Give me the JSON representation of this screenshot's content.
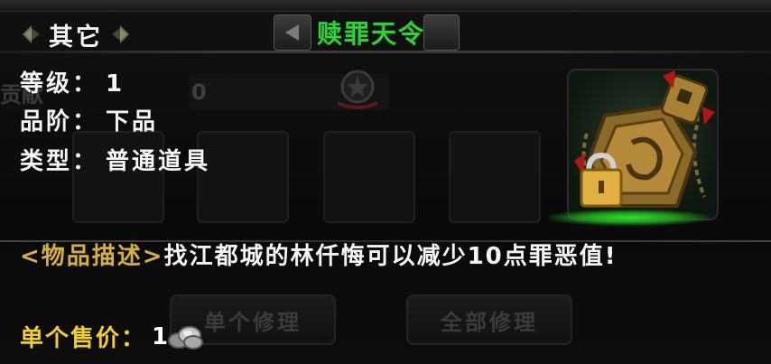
{
  "category": {
    "label": "其它"
  },
  "title": "赎罪天令",
  "background": {
    "label": "贡献",
    "value": "0"
  },
  "attributes": [
    {
      "label": "等级：",
      "value": "1"
    },
    {
      "label": "品阶：",
      "value": "下品"
    },
    {
      "label": "类型：",
      "value": "普通道具"
    }
  ],
  "item": {
    "icon": "lock-seal-icon",
    "glow_color": "#34e031"
  },
  "description": {
    "tag": "<物品描述>",
    "text": "找江都城的林仟悔可以减少10点罪恶值!"
  },
  "buttons": {
    "repair_single": "单个修理",
    "repair_all": "全部修理"
  },
  "price": {
    "label": "单个售价：",
    "value": "1",
    "currency_icon": "silver-coin-icon"
  },
  "colors": {
    "title": "#2fd03a",
    "tag": "#d7b23a",
    "price_label": "#f0d12a"
  }
}
